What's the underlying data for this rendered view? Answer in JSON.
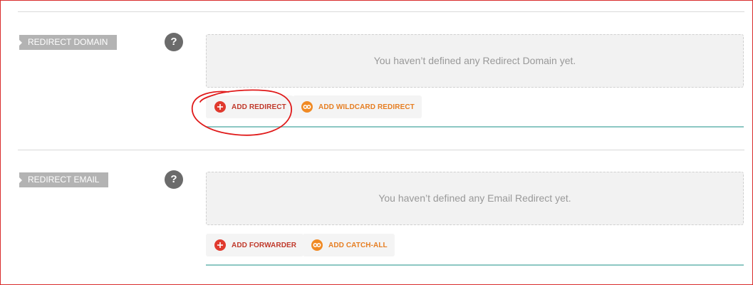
{
  "sections": {
    "redirect_domain": {
      "label": "REDIRECT DOMAIN",
      "help_icon_glyph": "?",
      "empty_message": "You haven’t defined any Redirect Domain yet.",
      "buttons": {
        "primary_label": "ADD REDIRECT",
        "secondary_label": "ADD WILDCARD REDIRECT"
      }
    },
    "redirect_email": {
      "label": "REDIRECT EMAIL",
      "help_icon_glyph": "?",
      "empty_message": "You haven’t defined any Email Redirect yet.",
      "buttons": {
        "primary_label": "ADD FORWARDER",
        "secondary_label": "ADD CATCH-ALL"
      }
    }
  },
  "icons": {
    "add": "plus-circle-icon",
    "wildcard": "infinity-circle-icon",
    "help": "question-circle-icon"
  },
  "colors": {
    "label_tag_bg": "#b3b3b3",
    "help_icon_bg": "#6b6b6b",
    "add_red": "#e03a2e",
    "add_text_red": "#c0392b",
    "wildcard_orange": "#f08a24",
    "wildcard_text_orange": "#e67e22",
    "empty_box_bg": "#f2f2f2",
    "teal_divider": "#8cc7c3",
    "annotation_red": "#e01a1a",
    "frame_border": "#d92c2c"
  },
  "annotation": {
    "type": "hand-drawn-circle",
    "target": "add-redirect-button"
  }
}
